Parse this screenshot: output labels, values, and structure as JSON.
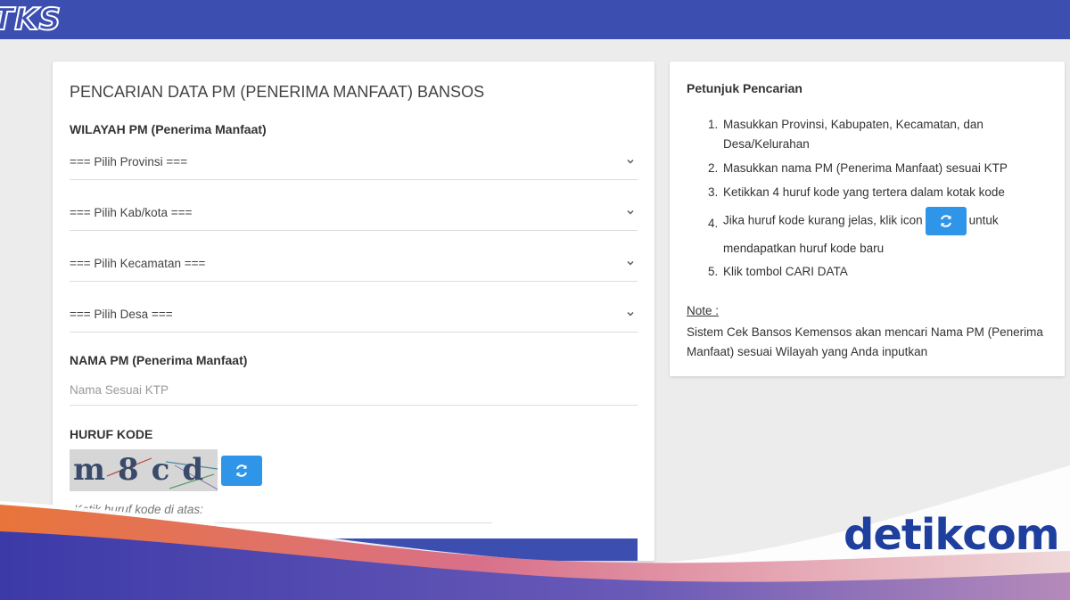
{
  "header": {
    "logo_text": "TKS"
  },
  "search_form": {
    "title": "PENCARIAN DATA PM (PENERIMA MANFAAT) BANSOS",
    "region_label": "WILAYAH PM (Penerima Manfaat)",
    "selects": [
      {
        "value": "=== Pilih Provinsi ==="
      },
      {
        "value": "=== Pilih Kab/kota ==="
      },
      {
        "value": "=== Pilih Kecamatan ==="
      },
      {
        "value": "=== Pilih Desa ==="
      }
    ],
    "name_label": "NAMA PM (Penerima Manfaat)",
    "name_placeholder": "Nama Sesuai KTP",
    "code_label": "HURUF KODE",
    "captcha_text": "m8cd",
    "code_placeholder": "Ketik huruf kode di atas:"
  },
  "guide": {
    "title": "Petunjuk Pencarian",
    "steps": [
      {
        "num": "1.",
        "text": "Masukkan Provinsi, Kabupaten, Kecamatan, dan Desa/Kelurahan"
      },
      {
        "num": "2.",
        "text": "Masukkan nama PM (Penerima Manfaat) sesuai KTP"
      },
      {
        "num": "3.",
        "text": "Ketikkan 4 huruf kode yang tertera dalam kotak kode"
      },
      {
        "num": "4.",
        "text_before": "Jika huruf kode kurang jelas, klik icon",
        "text_after": "untuk mendapatkan huruf kode baru"
      },
      {
        "num": "5.",
        "text": "Klik tombol CARI DATA"
      }
    ],
    "note_label": "Note :",
    "note_text": "Sistem Cek Bansos Kemensos akan mencari Nama PM (Penerima Manfaat) sesuai Wilayah yang Anda inputkan"
  },
  "watermark": {
    "text": "detikcom"
  },
  "icons": {
    "refresh": "refresh-icon",
    "chevron": "chevron-down-icon"
  },
  "colors": {
    "primary": "#3c4eb0",
    "button": "#2e95e8",
    "background": "#ececec",
    "watermark": "#1f3f9f"
  }
}
